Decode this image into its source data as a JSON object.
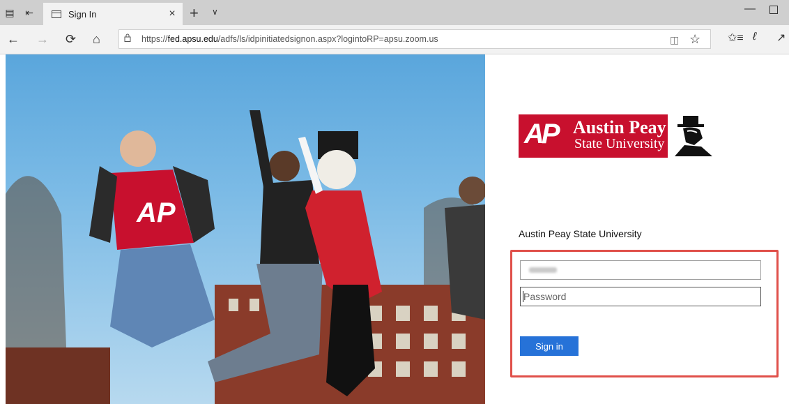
{
  "browser": {
    "tab_title": "Sign In",
    "tab_close": "×",
    "new_tab": "+",
    "tab_menu": "∨",
    "url_scheme": "https://",
    "url_host": "fed.apsu.edu",
    "url_path": "/adfs/ls/idpinitiatedsignon.aspx?logintoRP=apsu.zoom.us",
    "nav": {
      "back": "←",
      "forward": "→",
      "refresh": "⟳",
      "home": "⌂"
    },
    "icons": {
      "reading_view": "reading-view-icon",
      "favorite": "star-icon",
      "favorites": "favorites-hub-icon",
      "notes": "pen-icon",
      "share": "share-icon"
    }
  },
  "logo": {
    "mark": "AP",
    "name_line1": "Austin Peay",
    "name_line2": "State University"
  },
  "login": {
    "org_name": "Austin Peay State University",
    "username_value": "",
    "password_placeholder": "Password",
    "sign_in_label": "Sign in"
  },
  "colors": {
    "brand_red": "#c8102e",
    "button_blue": "#2672d8",
    "highlight_red": "#e0504a"
  }
}
